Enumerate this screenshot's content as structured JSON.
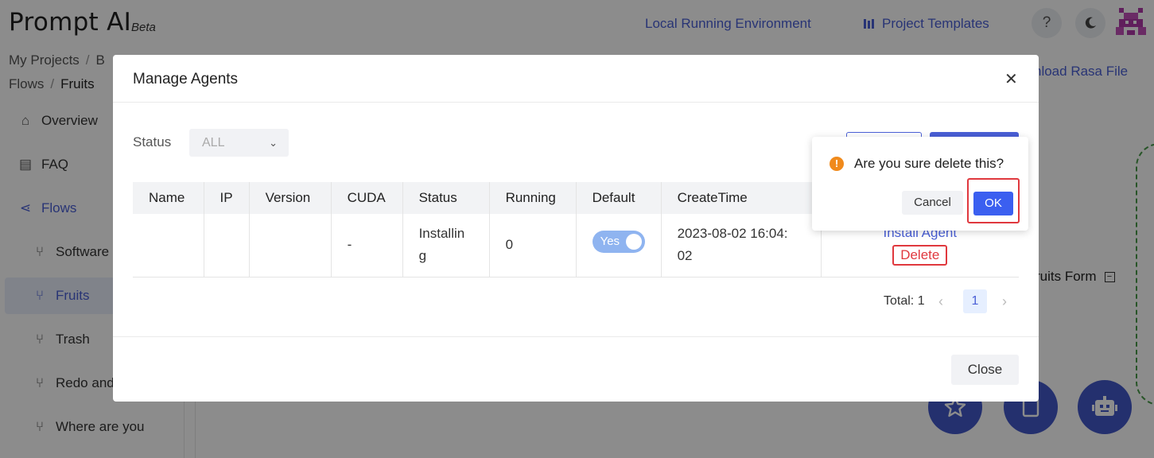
{
  "app": {
    "name": "Prompt AI",
    "badge": "Beta"
  },
  "topnav": {
    "local_env": "Local Running Environment",
    "templates": "Project Templates",
    "help_icon": "question-icon",
    "theme_icon": "moon-icon"
  },
  "breadcrumb": {
    "root": "My Projects",
    "project": "B",
    "section": "Flows",
    "current": "Fruits"
  },
  "sidebar": {
    "items": [
      {
        "label": "Overview",
        "icon": "home-icon"
      },
      {
        "label": "FAQ",
        "icon": "book-icon"
      },
      {
        "label": "Flows",
        "icon": "flow-icon"
      },
      {
        "label": "Software",
        "icon": "branch-icon"
      },
      {
        "label": "Fruits",
        "icon": "branch-icon"
      },
      {
        "label": "Trash",
        "icon": "branch-icon"
      },
      {
        "label": "Redo and",
        "icon": "branch-icon"
      },
      {
        "label": "Where are you",
        "icon": "branch-icon"
      }
    ]
  },
  "canvas": {
    "download_link": "nload Rasa File",
    "node_label": "ruits Form",
    "colors": {
      "fab": "#4358c9",
      "dashed": "#4a9c4a"
    }
  },
  "modal": {
    "title": "Manage Agents",
    "filter": {
      "label": "Status",
      "value": "ALL"
    },
    "table": {
      "headers": [
        "Name",
        "IP",
        "Version",
        "CUDA",
        "Status",
        "Running",
        "Default",
        "CreateTime",
        ""
      ],
      "rows": [
        {
          "name": "",
          "ip": "",
          "version": "",
          "cuda": "-",
          "status_line1": "Installin",
          "status_line2": "g",
          "running": "0",
          "default_label": "Yes",
          "create_line1": "2023-08-02 16:04:",
          "create_line2": "02",
          "action_install": "Install Agent",
          "action_delete": "Delete"
        }
      ]
    },
    "pagination": {
      "total_label": "Total: 1",
      "current_page": "1"
    },
    "close_label": "Close"
  },
  "popconfirm": {
    "message": "Are you sure delete this?",
    "cancel": "Cancel",
    "ok": "OK"
  }
}
